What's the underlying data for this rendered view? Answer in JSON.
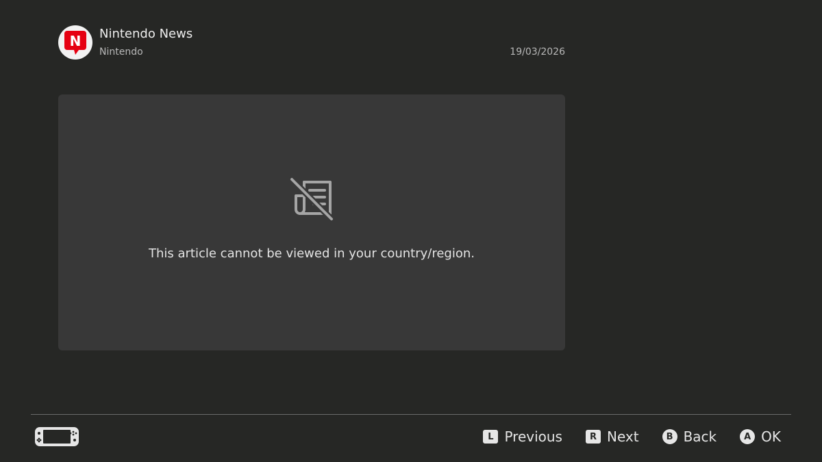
{
  "header": {
    "channel_title": "Nintendo News",
    "publisher": "Nintendo",
    "date": "19/03/2026",
    "logo_letter": "N"
  },
  "article": {
    "message": "This article cannot be viewed in your country/region.",
    "icon": "news-unavailable-icon"
  },
  "footer": {
    "hints": [
      {
        "button": "L",
        "label": "Previous"
      },
      {
        "button": "R",
        "label": "Next"
      },
      {
        "button": "B",
        "label": "Back"
      },
      {
        "button": "A",
        "label": "OK"
      }
    ]
  },
  "colors": {
    "background": "#262725",
    "panel": "#383838",
    "brand_red": "#e60012",
    "text": "#e6e6e6",
    "muted_text": "#b8b8b8"
  }
}
